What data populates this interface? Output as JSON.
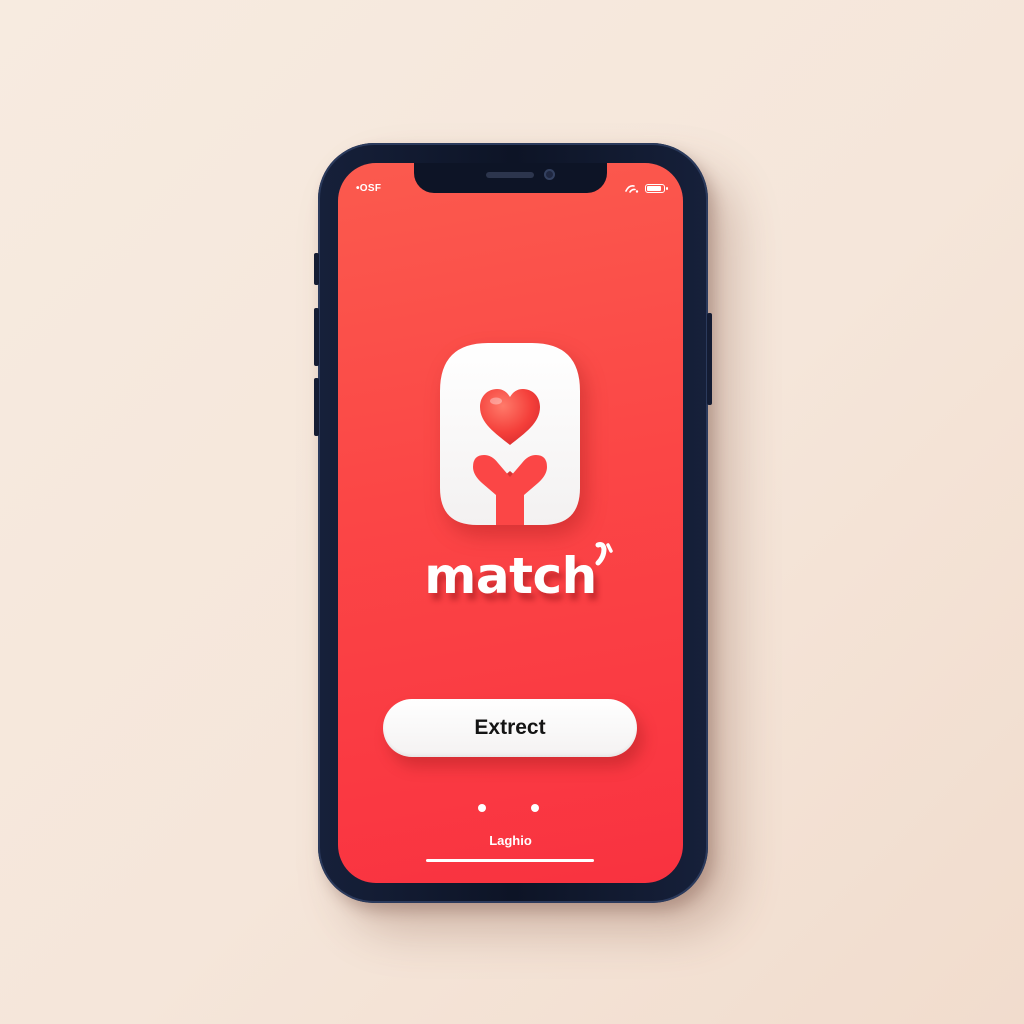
{
  "status_bar": {
    "left_text": "•OSF",
    "right_icons": [
      "signal-icon",
      "battery-icon"
    ]
  },
  "logo": {
    "icon": "heart-pin-logo-icon",
    "wordmark": "match",
    "colors": {
      "background": "#fb4646",
      "heart": "#f4413e",
      "tile": "#ffffff"
    }
  },
  "primary_button": {
    "label": "Extrect"
  },
  "pagination": {
    "dot_count": 2
  },
  "bottom_link": {
    "label": "Laghio"
  }
}
